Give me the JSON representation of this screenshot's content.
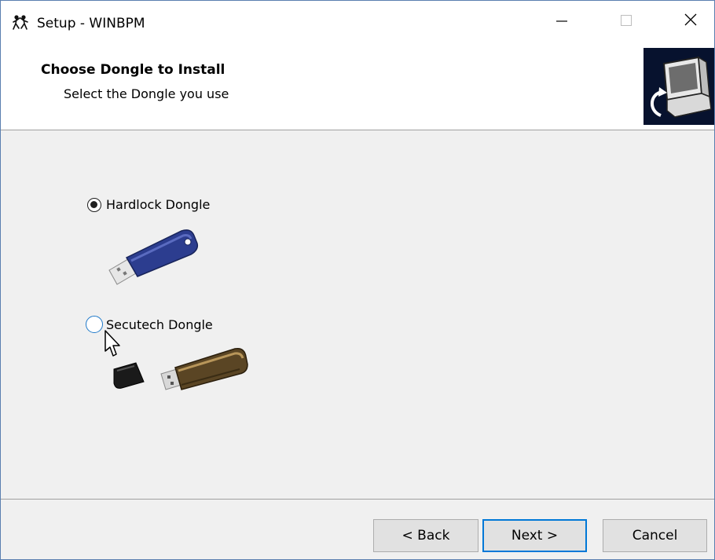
{
  "window": {
    "title": "Setup - WINBPM"
  },
  "header": {
    "title": "Choose Dongle to Install",
    "subtitle": "Select the Dongle you use"
  },
  "options": [
    {
      "label": "Hardlock Dongle",
      "selected": true
    },
    {
      "label": "Secutech Dongle",
      "selected": false
    }
  ],
  "buttons": {
    "back": "< Back",
    "next": "Next >",
    "cancel": "Cancel"
  },
  "colors": {
    "accent": "#0078d7",
    "header_logo_bg": "#07122e",
    "dialog_bg": "#f0f0f0"
  },
  "icons": {
    "app": "installer-people-icon",
    "minimize": "minimize-icon",
    "maximize": "maximize-icon",
    "close": "close-icon",
    "logo": "computer-install-icon",
    "cursor": "mouse-pointer-icon"
  }
}
